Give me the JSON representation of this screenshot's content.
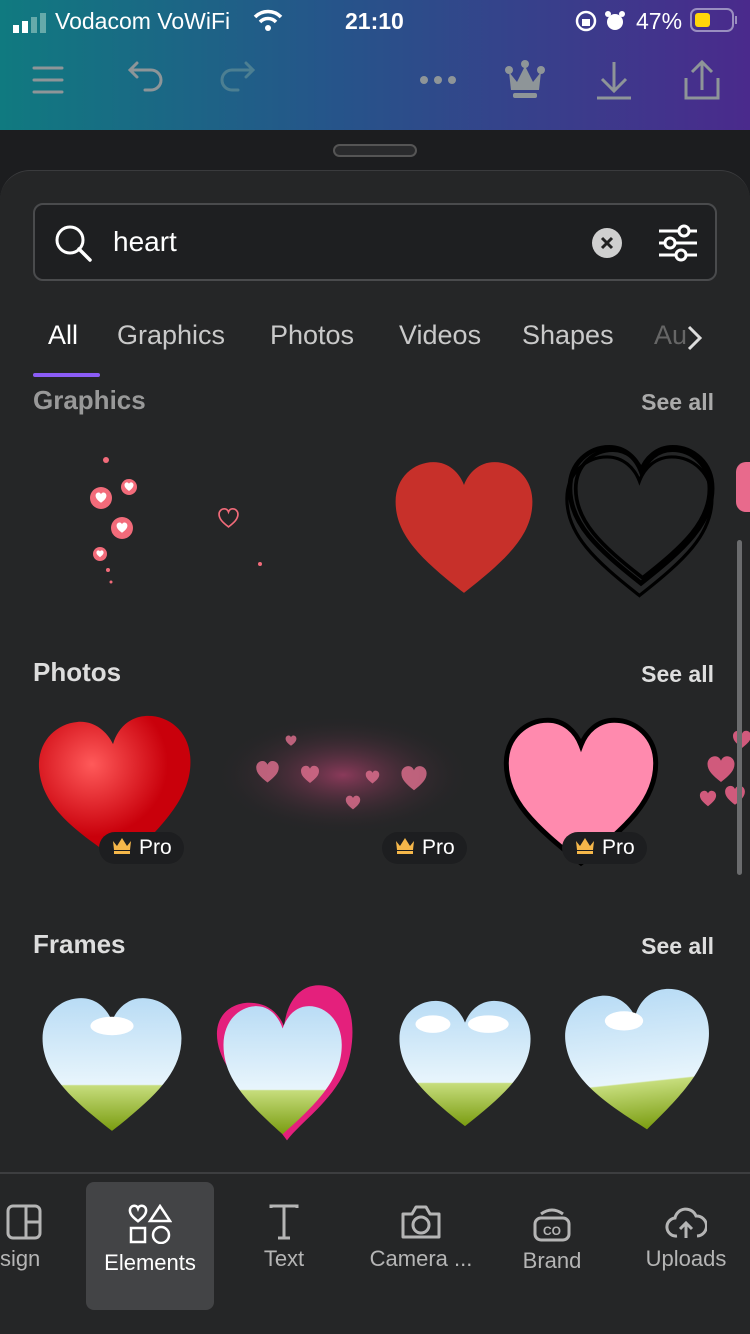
{
  "status_bar": {
    "carrier": "Vodacom VoWiFi",
    "time": "21:10",
    "battery": "47%",
    "battery_level": 0.47
  },
  "toolbar": {
    "icons": [
      "menu-icon",
      "undo-icon",
      "redo-icon",
      "more-icon",
      "crown-icon",
      "download-icon",
      "share-icon"
    ]
  },
  "search": {
    "value": "heart",
    "placeholder": "Search"
  },
  "tabs": [
    {
      "label": "All",
      "active": true
    },
    {
      "label": "Graphics"
    },
    {
      "label": "Photos"
    },
    {
      "label": "Videos"
    },
    {
      "label": "Shapes"
    },
    {
      "label": "Au"
    }
  ],
  "sections": {
    "graphics": {
      "title": "Graphics",
      "see_all": "See all"
    },
    "photos": {
      "title": "Photos",
      "see_all": "See all",
      "badge": "Pro"
    },
    "frames": {
      "title": "Frames",
      "see_all": "See all"
    }
  },
  "nav": [
    {
      "label": "esign"
    },
    {
      "label": "Elements",
      "active": true
    },
    {
      "label": "Text"
    },
    {
      "label": "Camera ..."
    },
    {
      "label": "Brand"
    },
    {
      "label": "Uploads"
    }
  ],
  "colors": {
    "accent": "#8b5cf6",
    "heart_red": "#c7302a",
    "pink": "#ff8aae"
  }
}
